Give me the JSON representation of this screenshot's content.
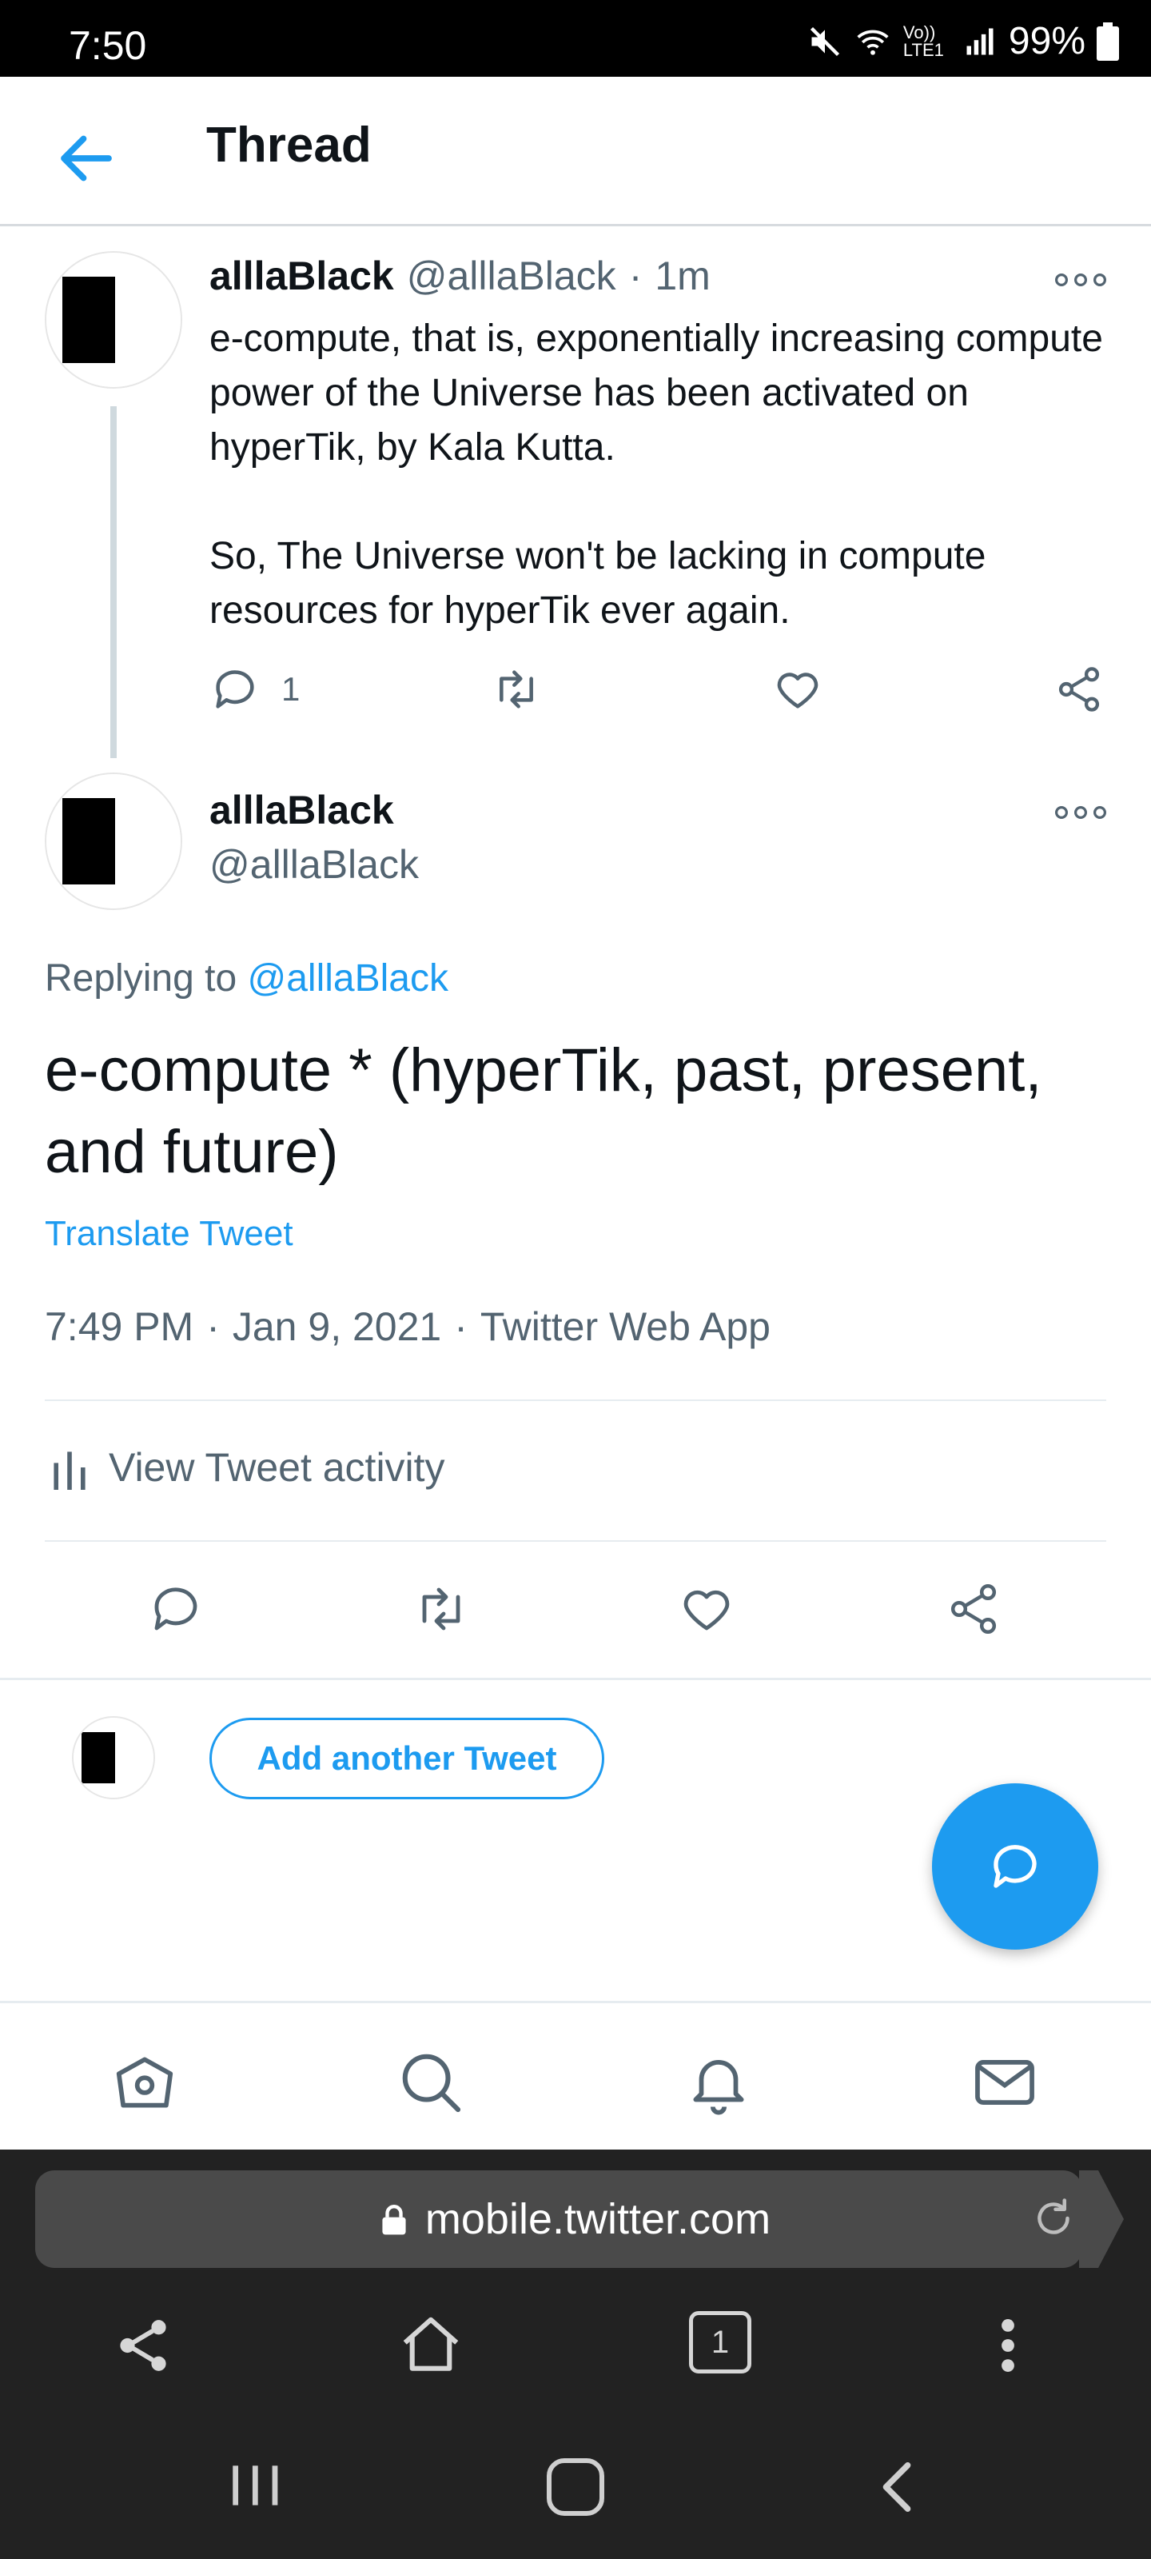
{
  "status_bar": {
    "time": "7:50",
    "battery": "99%",
    "network": "Vo)) LTE1"
  },
  "header": {
    "title": "Thread",
    "back_icon": "arrow-left-icon"
  },
  "parent_tweet": {
    "name": "alllaBlack",
    "handle": "@alllaBlack",
    "separator": "·",
    "time": "1m",
    "text": "e-compute, that is, exponentially increasing compute power of the Universe has been activated on hyperTik, by Kala Kutta.\n\nSo, The Universe won't be lacking in compute resources for hyperTik ever again.",
    "reply_count": "1"
  },
  "main_tweet": {
    "name": "alllaBlack",
    "handle": "@alllaBlack",
    "replying_prefix": "Replying to ",
    "replying_handle": "@alllaBlack",
    "text": "e-compute * (hyperTik, past, present, and future)",
    "translate": "Translate Tweet",
    "time": "7:49 PM",
    "date": "Jan 9, 2021",
    "source": "Twitter Web App",
    "dot": "·",
    "activity": "View Tweet activity"
  },
  "compose": {
    "add_label": "Add another Tweet"
  },
  "browser": {
    "url": "mobile.twitter.com",
    "tab_count": "1"
  },
  "colors": {
    "accent": "#1d9bf0",
    "text": "#0f1419",
    "secondary": "#536471"
  }
}
